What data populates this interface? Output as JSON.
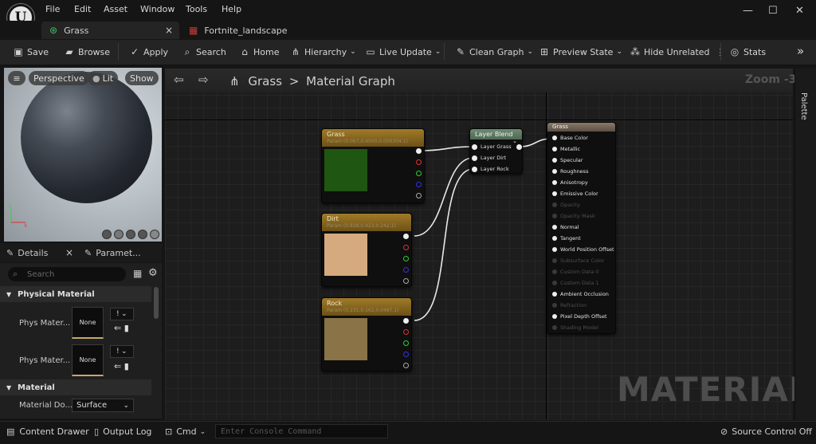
{
  "menu": [
    "File",
    "Edit",
    "Asset",
    "Window",
    "Tools",
    "Help"
  ],
  "window_controls": {
    "minimize": "—",
    "maximize": "☐",
    "close": "✕"
  },
  "tabs": [
    {
      "label": "Grass",
      "close": "×"
    },
    {
      "label": "Fortnite_landscape"
    }
  ],
  "toolbar": {
    "save": "Save",
    "browse": "Browse",
    "apply": "Apply",
    "search": "Search",
    "home": "Home",
    "hierarchy": "Hierarchy",
    "live_update": "Live Update",
    "clean_graph": "Clean Graph",
    "preview_state": "Preview State",
    "hide_unrelated": "Hide Unrelated",
    "stats": "Stats",
    "more": "»"
  },
  "viewport": {
    "perspective": "Perspective",
    "lit": "Lit",
    "show": "Show"
  },
  "details": {
    "tab_details": "Details",
    "tab_close": "×",
    "tab_params": "Paramet...",
    "search_placeholder": "Search",
    "section_physical": "Physical Material",
    "phys_rows": [
      {
        "label": "Phys Mater...",
        "value": "None"
      },
      {
        "label": "Phys Mater...",
        "value": "None"
      }
    ],
    "section_material": "Material",
    "material_domain_label": "Material Do...",
    "material_domain_value": "Surface"
  },
  "graph": {
    "breadcrumb_root": "Grass",
    "breadcrumb_sep": ">",
    "breadcrumb_current": "Material Graph",
    "zoom": "Zoom -3",
    "watermark": "MATERIAL",
    "palette": "Palette"
  },
  "nodes": {
    "grass": {
      "title": "Grass",
      "subtitle": "Param (0.067,0.4500,0.000304,1)",
      "color": "#1f5611"
    },
    "dirt": {
      "title": "Dirt",
      "subtitle": "Param (0.838,0.423,0.242,1)",
      "color": "#d5aa7e"
    },
    "rock": {
      "title": "Rock",
      "subtitle": "Param (0.231,0.162,0.0497,1)",
      "color": "#8a7347"
    },
    "layer_blend": {
      "title": "Layer Blend",
      "inputs": [
        "Layer Grass",
        "Layer Dirt",
        "Layer Rock"
      ]
    },
    "material": {
      "title": "Grass",
      "inputs": [
        {
          "label": "Base Color",
          "enabled": true
        },
        {
          "label": "Metallic",
          "enabled": true
        },
        {
          "label": "Specular",
          "enabled": true
        },
        {
          "label": "Roughness",
          "enabled": true
        },
        {
          "label": "Anisotropy",
          "enabled": true
        },
        {
          "label": "Emissive Color",
          "enabled": true
        },
        {
          "label": "Opacity",
          "enabled": false
        },
        {
          "label": "Opacity Mask",
          "enabled": false
        },
        {
          "label": "Normal",
          "enabled": true
        },
        {
          "label": "Tangent",
          "enabled": true
        },
        {
          "label": "World Position Offset",
          "enabled": true
        },
        {
          "label": "Subsurface Color",
          "enabled": false
        },
        {
          "label": "Custom Data 0",
          "enabled": false
        },
        {
          "label": "Custom Data 1",
          "enabled": false
        },
        {
          "label": "Ambient Occlusion",
          "enabled": true
        },
        {
          "label": "Refraction",
          "enabled": false
        },
        {
          "label": "Pixel Depth Offset",
          "enabled": true
        },
        {
          "label": "Shading Model",
          "enabled": false
        }
      ]
    }
  },
  "statusbar": {
    "content_drawer": "Content Drawer",
    "output_log": "Output Log",
    "cmd": "Cmd",
    "console_placeholder": "Enter Console Command",
    "source_control": "Source Control Off"
  }
}
